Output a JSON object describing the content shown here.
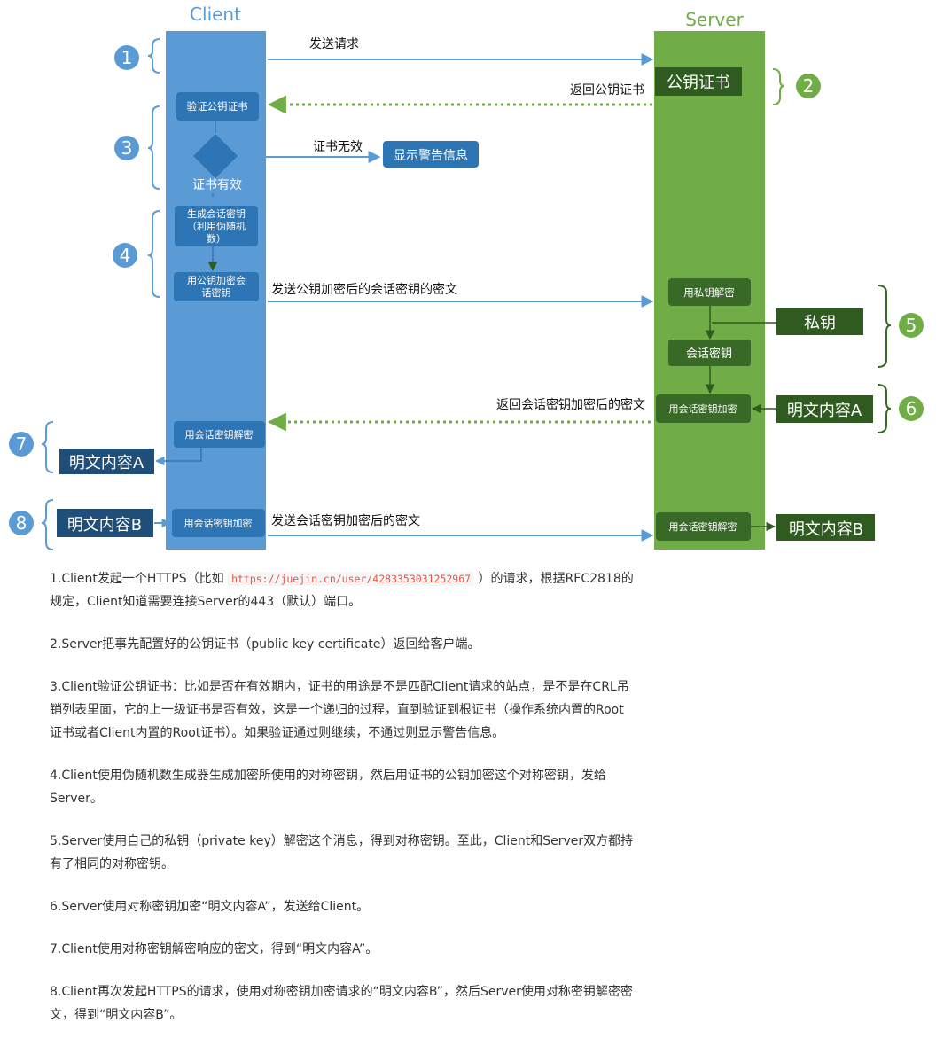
{
  "lanes": {
    "client_title": "Client",
    "server_title": "Server",
    "client_color": "#5b9bd5",
    "server_color": "#70ad47"
  },
  "colors": {
    "client_box": "#2e75b6",
    "server_box": "#386926",
    "dark_box": "#2f5a20",
    "number_circle": "#5b9bd5",
    "number_circle_green": "#70ad47",
    "arrow_blue": "#5b9bd5",
    "arrow_green": "#70ad47"
  },
  "numbers": [
    "1",
    "2",
    "3",
    "4",
    "5",
    "6",
    "7",
    "8"
  ],
  "client_boxes": {
    "verify_cert": "验证公钥证书",
    "gen_key_1": "生成会话密钥",
    "gen_key_2": "（利用伪随机",
    "gen_key_3": "数）",
    "encrypt_key_1": "用公钥加密会",
    "encrypt_key_2": "话密钥",
    "decrypt_session": "用会话密钥解密",
    "encrypt_session": "用会话密钥加密"
  },
  "server_boxes": {
    "public_cert": "公钥证书",
    "private_decrypt": "用私钥解密",
    "session_key": "会话密钥",
    "session_encrypt": "用会话密钥加密",
    "session_decrypt": "用会话密钥解密"
  },
  "outside_boxes": {
    "warning": "显示警告信息",
    "private_key": "私钥",
    "plaintext_a_server": "明文内容A",
    "plaintext_a_client": "明文内容A",
    "plaintext_b_client": "明文内容B",
    "plaintext_b_server": "明文内容B"
  },
  "labels": {
    "send_request": "发送请求",
    "return_cert": "返回公钥证书",
    "cert_invalid": "证书无效",
    "cert_valid": "证书有效",
    "send_encrypted_key": "发送公钥加密后的会话密钥的密文",
    "return_encrypted": "返回会话密钥加密后的密文",
    "send_encrypted": "发送会话密钥加密后的密文"
  },
  "steps": {
    "s1_pre": "1.Client发起一个HTTPS（比如",
    "s1_url": "https://juejin.cn/user/4283353031252967",
    "s1_post": "）的请求，根据RFC2818的规定，Client知道需要连接Server的443（默认）端口。",
    "s2": "2.Server把事先配置好的公钥证书（public key certificate）返回给客户端。",
    "s3": "3.Client验证公钥证书：比如是否在有效期内，证书的用途是不是匹配Client请求的站点，是不是在CRL吊销列表里面，它的上一级证书是否有效，这是一个递归的过程，直到验证到根证书（操作系统内置的Root证书或者Client内置的Root证书）。如果验证通过则继续，不通过则显示警告信息。",
    "s4": "4.Client使用伪随机数生成器生成加密所使用的对称密钥，然后用证书的公钥加密这个对称密钥，发给Server。",
    "s5": "5.Server使用自己的私钥（private key）解密这个消息，得到对称密钥。至此，Client和Server双方都持有了相同的对称密钥。",
    "s6": "6.Server使用对称密钥加密“明文内容A”，发送给Client。",
    "s7": "7.Client使用对称密钥解密响应的密文，得到“明文内容A”。",
    "s8": "8.Client再次发起HTTPS的请求，使用对称密钥加密请求的“明文内容B”，然后Server使用对称密钥解密密文，得到“明文内容B”。"
  }
}
